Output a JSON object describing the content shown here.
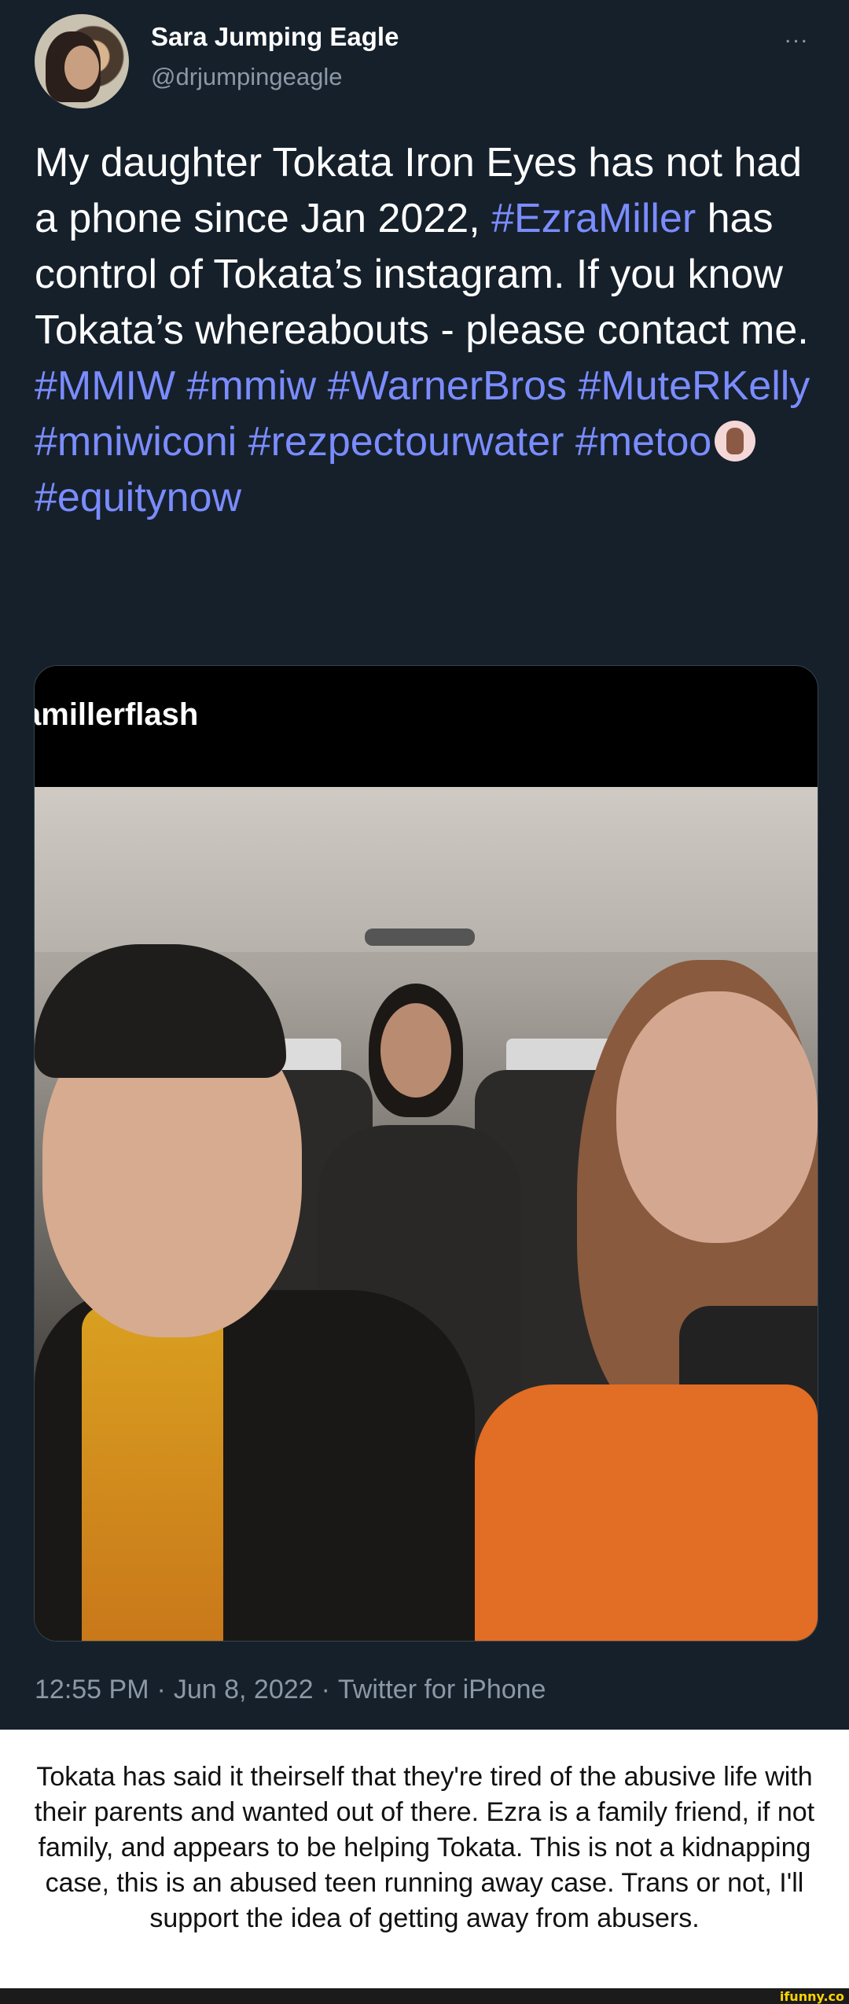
{
  "tweet": {
    "author_name": "Sara Jumping Eagle",
    "author_handle": "@drjumpingeagle",
    "more_icon": "...",
    "text_parts": {
      "line1": "My daughter Tokata Iron Eyes has not had a phone since Jan 2022,",
      "tag_ezra": "#EzraMiller",
      "line2": " has control of Tokata’s instagram. If you know Tokata’s whereabouts - please contact me.",
      "tag_mmiw_upper": "#MMIW",
      "tag_mmiw_lower": "#mmiw",
      "tag_warner": "#WarnerBros",
      "tag_muter": "#MuteRKelly",
      "tag_mniwiconi": "#mniwiconi",
      "tag_rezpect": "#rezpectourwater",
      "tag_metoo": "#metoo",
      "tag_equity": "#equitynow"
    },
    "emoji": "raised-hand-emoji",
    "media": {
      "overlay_handle": "amillerflash"
    },
    "timestamp": "12:55 PM",
    "date": "Jun 8, 2022",
    "source": "Twitter for iPhone",
    "separator": "·"
  },
  "comment": {
    "text": "Tokata has said it theirself that they're tired of the abusive life with their parents and wanted out of there. Ezra is a family friend, if not family, and appears to be helping Tokata. This is not a kidnapping case, this is an abused teen running away case. Trans or not, I'll support the idea of getting away from abusers."
  },
  "watermark": {
    "label": "ifunny.co"
  },
  "colors": {
    "background": "#15202b",
    "hashtag": "#7b8cff",
    "secondary_text": "#8b98a5",
    "watermark": "#ffd400"
  }
}
